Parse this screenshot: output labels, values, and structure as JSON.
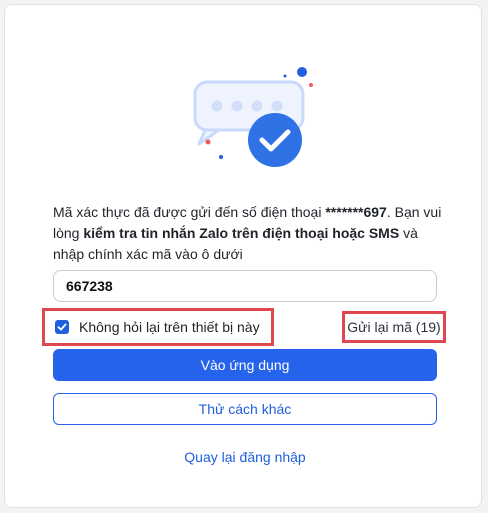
{
  "message": {
    "part1": "Mã xác thực đã được gửi đến số điện thoại ",
    "phone": "*******697",
    "part2": ". Bạn vui lòng ",
    "emphasis": "kiểm tra tin nhắn Zalo trên điện thoại hoặc SMS",
    "part3": " và nhập chính xác mã vào ô dưới"
  },
  "code_field": {
    "value": "667238"
  },
  "remember_device": {
    "label": "Không hỏi lại trên thiết bị này",
    "checked": true
  },
  "resend": {
    "label": "Gửi lại mã (19)"
  },
  "actions": {
    "enter_app": "Vào ứng dụng",
    "try_other": "Thử cách khác",
    "back_to_login": "Quay lại đăng nhập"
  },
  "icons": {
    "illustration": "verified-message-icon",
    "checkbox": "checkmark-icon"
  },
  "colors": {
    "primary": "#2563eb",
    "highlight_border": "#e0484f"
  }
}
